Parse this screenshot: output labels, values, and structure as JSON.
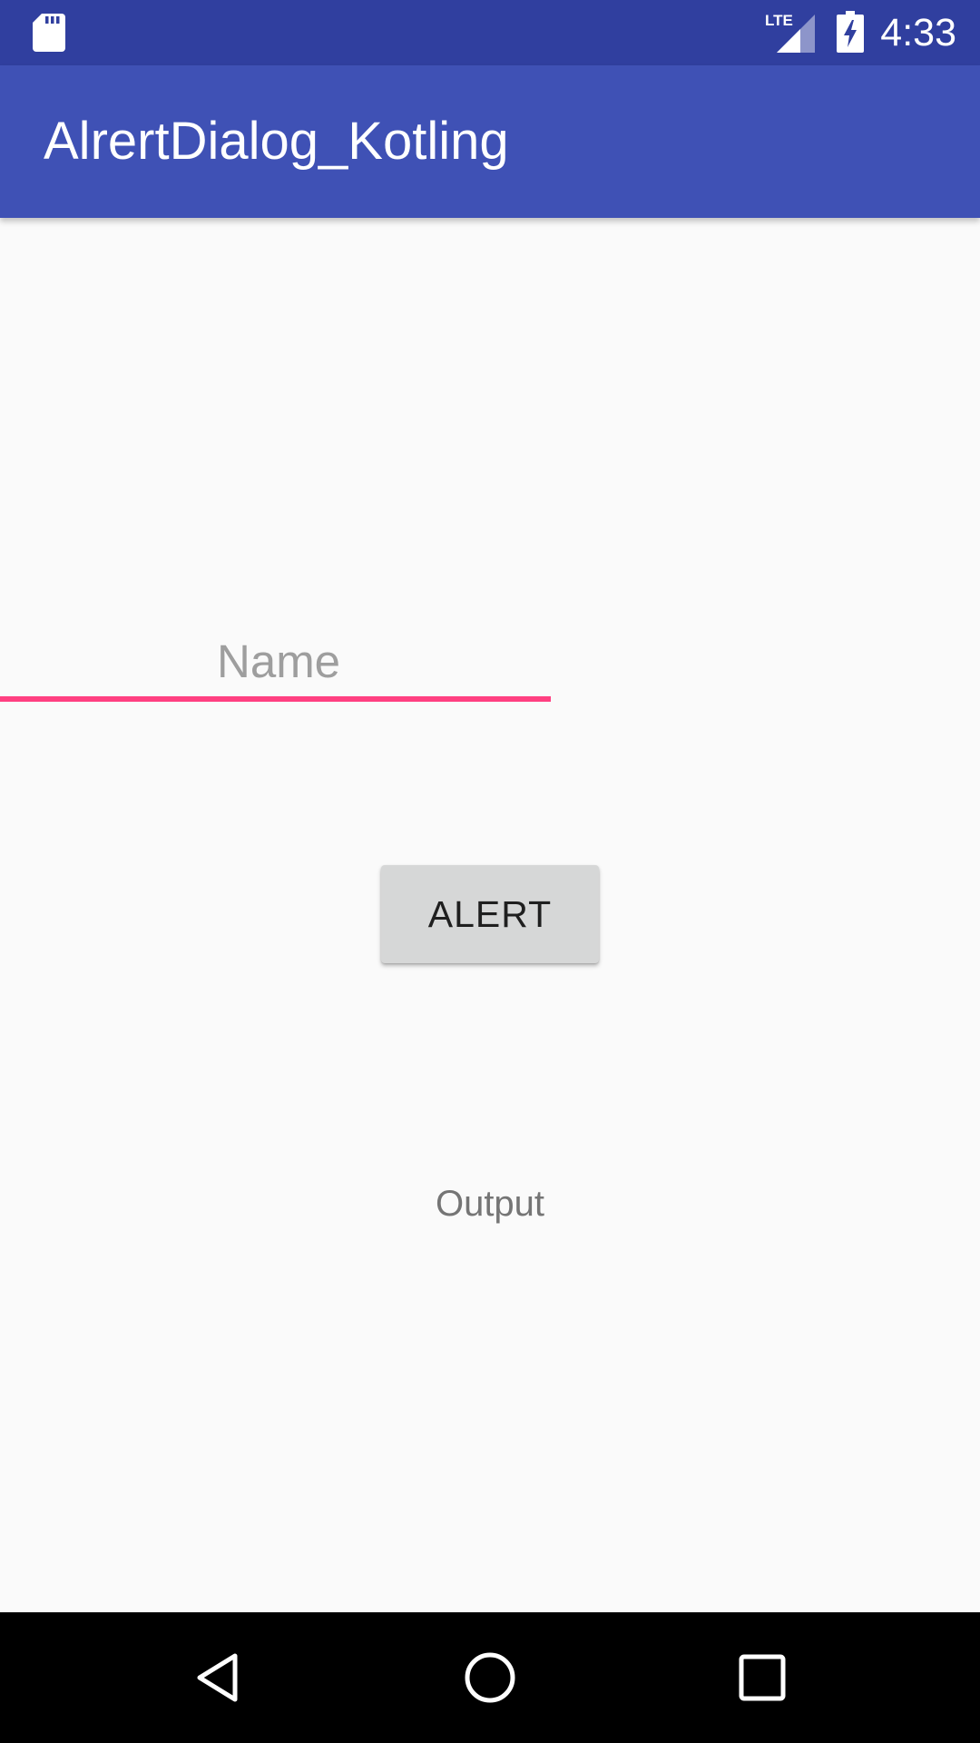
{
  "status_bar": {
    "time": "4:33",
    "network": "LTE",
    "icons": [
      "sd-card-icon",
      "lte-signal-icon",
      "battery-charging-icon"
    ],
    "background": "#303f9f"
  },
  "app_bar": {
    "title": "AlrertDialog_Kotling",
    "background": "#3f51b5"
  },
  "form": {
    "name_placeholder": "Name",
    "name_value": "",
    "underline_color": "#ff4081"
  },
  "alert_button": {
    "label": "ALERT"
  },
  "output": {
    "text": "Output"
  },
  "nav_bar": {
    "icons": [
      "back-icon",
      "home-icon",
      "recents-icon"
    ]
  }
}
